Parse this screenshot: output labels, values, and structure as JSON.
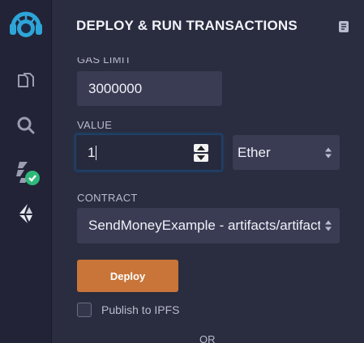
{
  "panel": {
    "title": "DEPLOY & RUN TRANSACTIONS"
  },
  "gas": {
    "label": "GAS LIMIT",
    "value": "3000000"
  },
  "value": {
    "label": "VALUE",
    "amount": "1",
    "unit": "Ether"
  },
  "contract": {
    "label": "CONTRACT",
    "selected": "SendMoneyExample - artifacts/artifacts"
  },
  "deploy": {
    "label": "Deploy"
  },
  "publish": {
    "label": "Publish to IPFS",
    "checked": false
  },
  "divider": {
    "text": "OR"
  },
  "colors": {
    "accent": "#c97539",
    "sidebar": "#222336",
    "panel": "#2a2c3f",
    "field": "#3a3c54",
    "logo": "#2ea5d8",
    "check": "#2fb87a"
  },
  "sidebar": {
    "icons": [
      "remix-logo-icon",
      "file-explorer-icon",
      "search-icon",
      "compiler-icon",
      "deploy-run-icon"
    ]
  }
}
